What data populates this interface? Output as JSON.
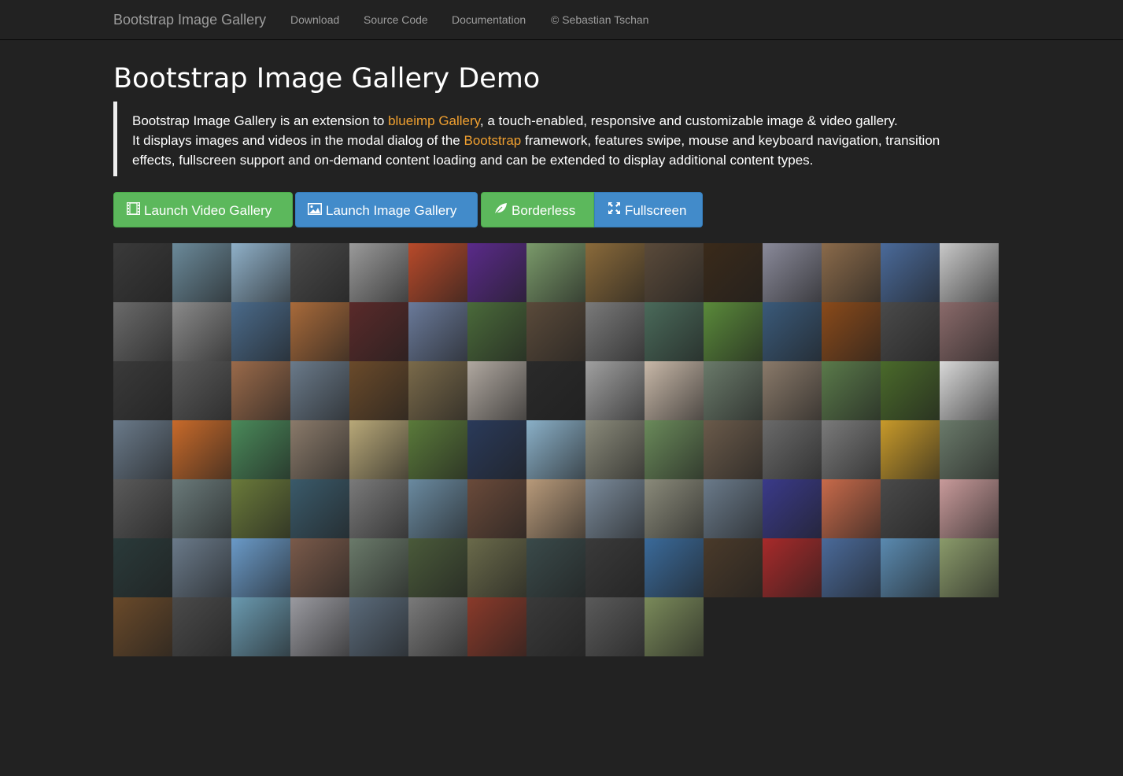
{
  "navbar": {
    "brand": "Bootstrap Image Gallery",
    "links": [
      "Download",
      "Source Code",
      "Documentation",
      "© Sebastian Tschan"
    ]
  },
  "page_title": "Bootstrap Image Gallery Demo",
  "lead": {
    "l1_before": "Bootstrap Image Gallery is an extension to ",
    "l1_link": "blueimp Gallery",
    "l1_after": ", a touch-enabled, responsive and customizable image & video gallery.",
    "l2_before": "It displays images and videos in the modal dialog of the ",
    "l2_link": "Bootstrap",
    "l2_after": " framework, features swipe, mouse and keyboard navigation, transition",
    "l3": "effects, fullscreen support and on-demand content loading and can be extended to display additional content types."
  },
  "buttons": {
    "video": "Launch Video Gallery",
    "image": "Launch Image Gallery",
    "borderless": "Borderless",
    "fullscreen": "Fullscreen"
  },
  "colors": {
    "background": "#222222",
    "link_accent": "#f0a030",
    "success": "#5cb85c",
    "primary": "#428bca"
  },
  "icons": {
    "video": "film-icon",
    "image": "picture-icon",
    "borderless": "leaf-icon",
    "fullscreen": "fullscreen-icon"
  },
  "gallery": {
    "columns": 15,
    "thumbnails": [
      "#3a3a3a",
      "#6b8a9a",
      "#8fb0c8",
      "#4a4a4a",
      "#9a9a9a",
      "#b84a2a",
      "#5a2a8a",
      "#7a9a6a",
      "#8a6a3a",
      "#5a4a3a",
      "#3a2a1a",
      "#8a8a9a",
      "#8a6a4a",
      "#4a6a9a",
      "#c8c8c8",
      "#6a6a6a",
      "#8a8a8a",
      "#4a6a8a",
      "#a86a3a",
      "#5a2a2a",
      "#6a7a9a",
      "#4a6a3a",
      "#5a4a3a",
      "#7a7a7a",
      "#4a6a5a",
      "#5a8a3a",
      "#3a5a7a",
      "#8a4a1a",
      "#4a4a4a",
      "#8a6a6a",
      "#3a3a3a",
      "#5a5a5a",
      "#9a6a4a",
      "#6a7a8a",
      "#6a4a2a",
      "#7a6a4a",
      "#b0a8a0",
      "#2a2a2a",
      "#a0a0a0",
      "#c8b8a8",
      "#6a7a6a",
      "#8a7a6a",
      "#5a7a4a",
      "#4a6a2a",
      "#d8d8d8",
      "#6a7a8a",
      "#c86a2a",
      "#4a8a5a",
      "#8a7a6a",
      "#b8a878",
      "#5a7a3a",
      "#2a3a5a",
      "#8ab0c8",
      "#8a8a7a",
      "#6a8a5a",
      "#6a5a4a",
      "#6a6a6a",
      "#7a7a7a",
      "#c89a2a",
      "#6a7a6a",
      "#5a5a5a",
      "#6a7a7a",
      "#6a7a3a",
      "#3a5a6a",
      "#7a7a7a",
      "#6a8aa0",
      "#6a4a3a",
      "#b89a7a",
      "#7a8a9a",
      "#8a8a7a",
      "#6a7a8a",
      "#3a3a8a",
      "#c86a4a",
      "#4a4a4a",
      "#c89a9a",
      "#2a3a3a",
      "#6a7a8a",
      "#6a9ac8",
      "#7a5a4a",
      "#6a7a6a",
      "#4a5a3a",
      "#6a6a4a",
      "#3a4a4a",
      "#3a3a3a",
      "#3a6a9a",
      "#4a3a2a",
      "#a82a2a",
      "#4a6a9a",
      "#5a8ab0",
      "#8a9a6a",
      "#6a4a2a",
      "#4a4a4a",
      "#6a9ab0",
      "#9a9aa0",
      "#5a6a7a",
      "#7a7a7a",
      "#8a3a2a",
      "#3a3a3a",
      "#5a5a5a",
      "#7a8a5a"
    ]
  }
}
